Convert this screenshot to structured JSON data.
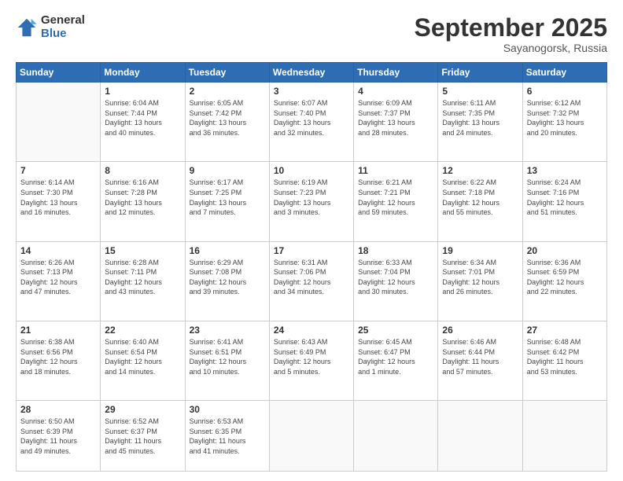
{
  "logo": {
    "general": "General",
    "blue": "Blue"
  },
  "title": {
    "month": "September 2025",
    "location": "Sayanogorsk, Russia"
  },
  "weekdays": [
    "Sunday",
    "Monday",
    "Tuesday",
    "Wednesday",
    "Thursday",
    "Friday",
    "Saturday"
  ],
  "weeks": [
    [
      {
        "day": "",
        "info": ""
      },
      {
        "day": "1",
        "info": "Sunrise: 6:04 AM\nSunset: 7:44 PM\nDaylight: 13 hours\nand 40 minutes."
      },
      {
        "day": "2",
        "info": "Sunrise: 6:05 AM\nSunset: 7:42 PM\nDaylight: 13 hours\nand 36 minutes."
      },
      {
        "day": "3",
        "info": "Sunrise: 6:07 AM\nSunset: 7:40 PM\nDaylight: 13 hours\nand 32 minutes."
      },
      {
        "day": "4",
        "info": "Sunrise: 6:09 AM\nSunset: 7:37 PM\nDaylight: 13 hours\nand 28 minutes."
      },
      {
        "day": "5",
        "info": "Sunrise: 6:11 AM\nSunset: 7:35 PM\nDaylight: 13 hours\nand 24 minutes."
      },
      {
        "day": "6",
        "info": "Sunrise: 6:12 AM\nSunset: 7:32 PM\nDaylight: 13 hours\nand 20 minutes."
      }
    ],
    [
      {
        "day": "7",
        "info": "Sunrise: 6:14 AM\nSunset: 7:30 PM\nDaylight: 13 hours\nand 16 minutes."
      },
      {
        "day": "8",
        "info": "Sunrise: 6:16 AM\nSunset: 7:28 PM\nDaylight: 13 hours\nand 12 minutes."
      },
      {
        "day": "9",
        "info": "Sunrise: 6:17 AM\nSunset: 7:25 PM\nDaylight: 13 hours\nand 7 minutes."
      },
      {
        "day": "10",
        "info": "Sunrise: 6:19 AM\nSunset: 7:23 PM\nDaylight: 13 hours\nand 3 minutes."
      },
      {
        "day": "11",
        "info": "Sunrise: 6:21 AM\nSunset: 7:21 PM\nDaylight: 12 hours\nand 59 minutes."
      },
      {
        "day": "12",
        "info": "Sunrise: 6:22 AM\nSunset: 7:18 PM\nDaylight: 12 hours\nand 55 minutes."
      },
      {
        "day": "13",
        "info": "Sunrise: 6:24 AM\nSunset: 7:16 PM\nDaylight: 12 hours\nand 51 minutes."
      }
    ],
    [
      {
        "day": "14",
        "info": "Sunrise: 6:26 AM\nSunset: 7:13 PM\nDaylight: 12 hours\nand 47 minutes."
      },
      {
        "day": "15",
        "info": "Sunrise: 6:28 AM\nSunset: 7:11 PM\nDaylight: 12 hours\nand 43 minutes."
      },
      {
        "day": "16",
        "info": "Sunrise: 6:29 AM\nSunset: 7:08 PM\nDaylight: 12 hours\nand 39 minutes."
      },
      {
        "day": "17",
        "info": "Sunrise: 6:31 AM\nSunset: 7:06 PM\nDaylight: 12 hours\nand 34 minutes."
      },
      {
        "day": "18",
        "info": "Sunrise: 6:33 AM\nSunset: 7:04 PM\nDaylight: 12 hours\nand 30 minutes."
      },
      {
        "day": "19",
        "info": "Sunrise: 6:34 AM\nSunset: 7:01 PM\nDaylight: 12 hours\nand 26 minutes."
      },
      {
        "day": "20",
        "info": "Sunrise: 6:36 AM\nSunset: 6:59 PM\nDaylight: 12 hours\nand 22 minutes."
      }
    ],
    [
      {
        "day": "21",
        "info": "Sunrise: 6:38 AM\nSunset: 6:56 PM\nDaylight: 12 hours\nand 18 minutes."
      },
      {
        "day": "22",
        "info": "Sunrise: 6:40 AM\nSunset: 6:54 PM\nDaylight: 12 hours\nand 14 minutes."
      },
      {
        "day": "23",
        "info": "Sunrise: 6:41 AM\nSunset: 6:51 PM\nDaylight: 12 hours\nand 10 minutes."
      },
      {
        "day": "24",
        "info": "Sunrise: 6:43 AM\nSunset: 6:49 PM\nDaylight: 12 hours\nand 5 minutes."
      },
      {
        "day": "25",
        "info": "Sunrise: 6:45 AM\nSunset: 6:47 PM\nDaylight: 12 hours\nand 1 minute."
      },
      {
        "day": "26",
        "info": "Sunrise: 6:46 AM\nSunset: 6:44 PM\nDaylight: 11 hours\nand 57 minutes."
      },
      {
        "day": "27",
        "info": "Sunrise: 6:48 AM\nSunset: 6:42 PM\nDaylight: 11 hours\nand 53 minutes."
      }
    ],
    [
      {
        "day": "28",
        "info": "Sunrise: 6:50 AM\nSunset: 6:39 PM\nDaylight: 11 hours\nand 49 minutes."
      },
      {
        "day": "29",
        "info": "Sunrise: 6:52 AM\nSunset: 6:37 PM\nDaylight: 11 hours\nand 45 minutes."
      },
      {
        "day": "30",
        "info": "Sunrise: 6:53 AM\nSunset: 6:35 PM\nDaylight: 11 hours\nand 41 minutes."
      },
      {
        "day": "",
        "info": ""
      },
      {
        "day": "",
        "info": ""
      },
      {
        "day": "",
        "info": ""
      },
      {
        "day": "",
        "info": ""
      }
    ]
  ]
}
